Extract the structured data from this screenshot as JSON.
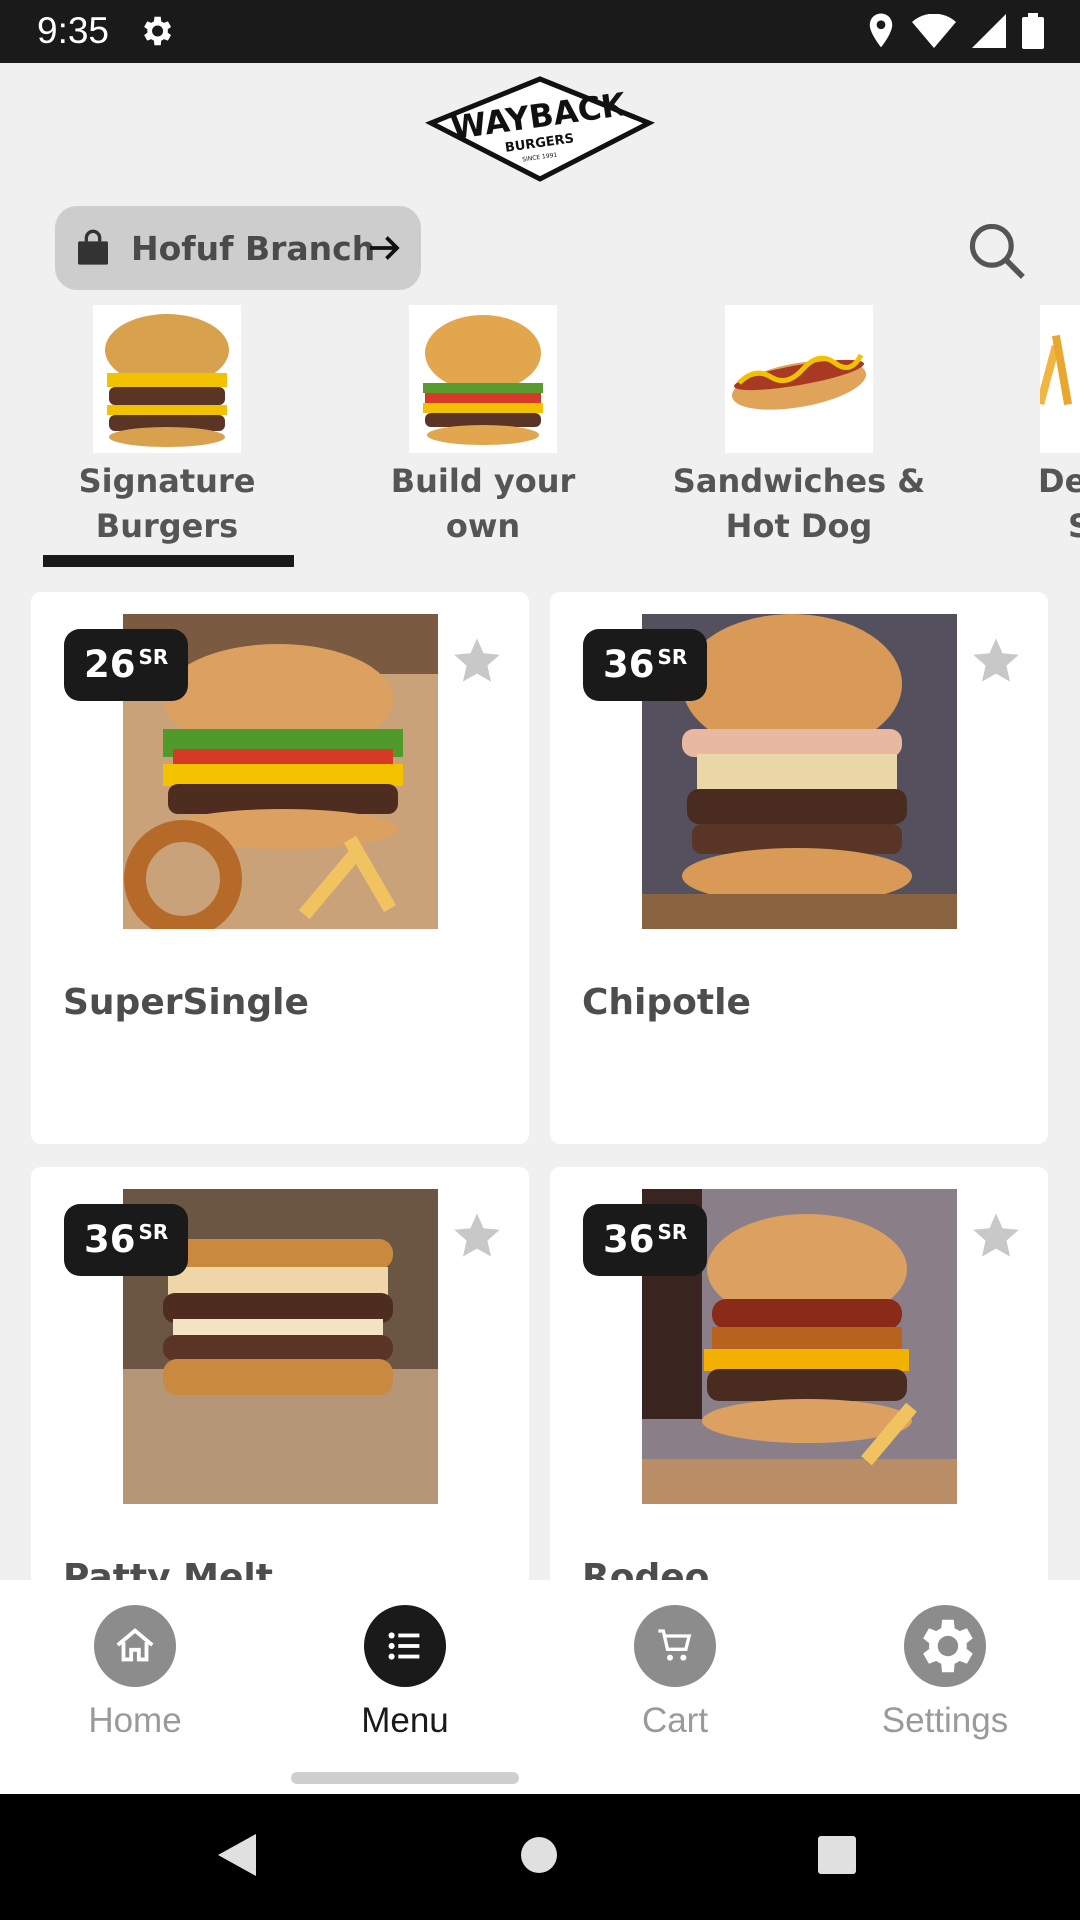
{
  "status_bar": {
    "time": "9:35"
  },
  "header": {
    "logo_main": "WAYBACK",
    "logo_sub": "BURGERS",
    "logo_since": "SINCE 1991"
  },
  "branch": {
    "label": "Hofuf Branch"
  },
  "categories": [
    {
      "label_line1": "Signature",
      "label_line2": "Burgers",
      "selected": true
    },
    {
      "label_line1": "Build your",
      "label_line2": "own",
      "selected": false
    },
    {
      "label_line1": "Sandwiches &",
      "label_line2": "Hot Dog",
      "selected": false
    },
    {
      "label_line1": "De",
      "label_line2": "S",
      "selected": false
    }
  ],
  "products": [
    {
      "name": "SuperSingle",
      "price": "26",
      "currency": "SR"
    },
    {
      "name": "Chipotle",
      "price": "36",
      "currency": "SR"
    },
    {
      "name": "Patty Melt",
      "price": "36",
      "currency": "SR"
    },
    {
      "name": "Rodeo",
      "price": "36",
      "currency": "SR"
    }
  ],
  "bottom_nav": [
    {
      "label": "Home",
      "icon": "home-icon",
      "active": false
    },
    {
      "label": "Menu",
      "icon": "list-icon",
      "active": true
    },
    {
      "label": "Cart",
      "icon": "cart-icon",
      "active": false
    },
    {
      "label": "Settings",
      "icon": "gear-icon",
      "active": false
    }
  ],
  "colors": {
    "accent": "#1a1a1a",
    "pill": "#cdcdcd",
    "background": "#f0f0f0"
  }
}
